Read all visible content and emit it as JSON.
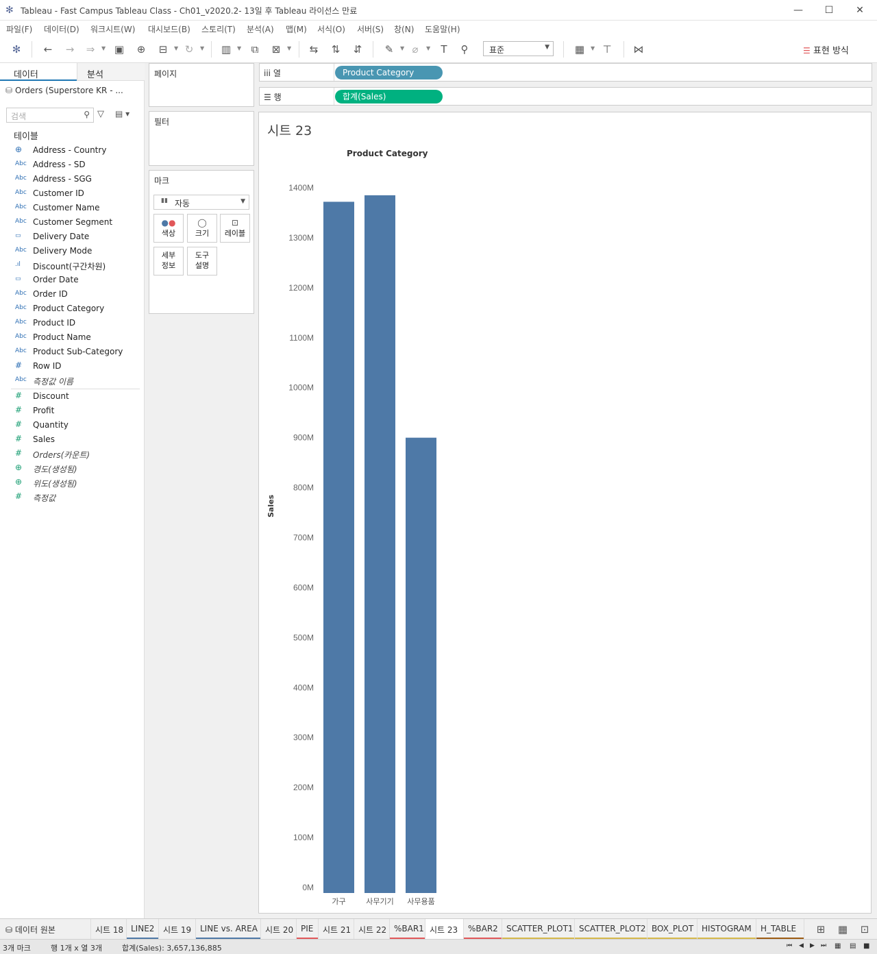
{
  "window": {
    "title": "Tableau - Fast Campus Tableau Class - Ch01_v2020.2- 13일 후 Tableau 라이선스 만료"
  },
  "menu": [
    "파일(F)",
    "데이터(D)",
    "워크시트(W)",
    "대시보드(B)",
    "스토리(T)",
    "분석(A)",
    "맵(M)",
    "서식(O)",
    "서버(S)",
    "창(N)",
    "도움말(H)"
  ],
  "toolbar": {
    "fit": "표준",
    "show_me": "표현 방식"
  },
  "data_pane": {
    "tab_data": "데이터",
    "tab_analysis": "분석",
    "datasource": "Orders (Superstore KR - ...",
    "search_placeholder": "검색",
    "tables_title": "테이블",
    "dimensions": [
      {
        "type": "geo",
        "name": "Address - Country"
      },
      {
        "type": "Abc",
        "name": "Address - SD"
      },
      {
        "type": "Abc",
        "name": "Address - SGG"
      },
      {
        "type": "Abc",
        "name": "Customer ID"
      },
      {
        "type": "Abc",
        "name": "Customer Name"
      },
      {
        "type": "Abc",
        "name": "Customer Segment"
      },
      {
        "type": "date",
        "name": "Delivery Date"
      },
      {
        "type": "Abc",
        "name": "Delivery Mode"
      },
      {
        "type": "bin",
        "name": "Discount(구간차원)"
      },
      {
        "type": "date",
        "name": "Order Date"
      },
      {
        "type": "Abc",
        "name": "Order ID"
      },
      {
        "type": "Abc",
        "name": "Product Category"
      },
      {
        "type": "Abc",
        "name": "Product ID"
      },
      {
        "type": "Abc",
        "name": "Product Name"
      },
      {
        "type": "Abc",
        "name": "Product Sub-Category"
      },
      {
        "type": "num",
        "name": "Row ID"
      },
      {
        "type": "Abc",
        "name": "측정값 이름",
        "italic": true
      }
    ],
    "measures": [
      {
        "type": "num",
        "name": "Discount"
      },
      {
        "type": "num",
        "name": "Profit"
      },
      {
        "type": "num",
        "name": "Quantity"
      },
      {
        "type": "num",
        "name": "Sales"
      },
      {
        "type": "num",
        "name": "Orders(카운트)",
        "italic": true
      },
      {
        "type": "geo",
        "name": "경도(생성됨)",
        "italic": true
      },
      {
        "type": "geo",
        "name": "위도(생성됨)",
        "italic": true
      },
      {
        "type": "num",
        "name": "측정값",
        "italic": true
      }
    ]
  },
  "cards": {
    "pages": "페이지",
    "filters": "필터",
    "marks": "마크",
    "mark_type": "자동",
    "buttons": {
      "color": "색상",
      "size": "크기",
      "label": "레이블",
      "detail": "세부\n정보",
      "tooltip": "도구\n설명"
    }
  },
  "shelves": {
    "columns_label": "열",
    "columns_pill": "Product Category",
    "rows_label": "행",
    "rows_pill": "합계(Sales)"
  },
  "sheet": {
    "title": "시트 23",
    "column_header": "Product Category",
    "y_axis_label": "Sales"
  },
  "chart_data": {
    "type": "bar",
    "categories": [
      "가구",
      "사무기기",
      "사무용품"
    ],
    "values": [
      1372000000,
      1385000000,
      900000000
    ],
    "xlabel": "",
    "ylabel": "Sales",
    "ylim": [
      0,
      1400000000
    ],
    "yticks": [
      "0M",
      "100M",
      "200M",
      "300M",
      "400M",
      "500M",
      "600M",
      "700M",
      "800M",
      "900M",
      "1000M",
      "1100M",
      "1200M",
      "1300M",
      "1400M"
    ],
    "bar_color": "#4e79a7",
    "grid": false
  },
  "sheet_tabs": [
    {
      "label": "시트 18",
      "color": ""
    },
    {
      "label": "LINE2",
      "color": "#4e79a7"
    },
    {
      "label": "시트 19",
      "color": ""
    },
    {
      "label": "LINE vs. AREA",
      "color": "#4e79a7"
    },
    {
      "label": "시트 20",
      "color": ""
    },
    {
      "label": "PIE",
      "color": "#e15759"
    },
    {
      "label": "시트 21",
      "color": ""
    },
    {
      "label": "시트 22",
      "color": ""
    },
    {
      "label": "%BAR1",
      "color": "#e15759"
    },
    {
      "label": "시트 23",
      "color": "",
      "active": true
    },
    {
      "label": "%BAR2",
      "color": "#e15759"
    },
    {
      "label": "SCATTER_PLOT1",
      "color": "#d6b94a"
    },
    {
      "label": "SCATTER_PLOT2",
      "color": "#d6b94a"
    },
    {
      "label": "BOX_PLOT",
      "color": "#d6b94a"
    },
    {
      "label": "HISTOGRAM",
      "color": "#d6b94a"
    },
    {
      "label": "H_TABLE",
      "color": "#9c5b12"
    }
  ],
  "datasource_tab": "데이터 원본",
  "status": {
    "marks": "3개 마크",
    "rows_cols": "행 1개 x 열 3개",
    "sum": "합계(Sales): 3,657,136,885"
  }
}
